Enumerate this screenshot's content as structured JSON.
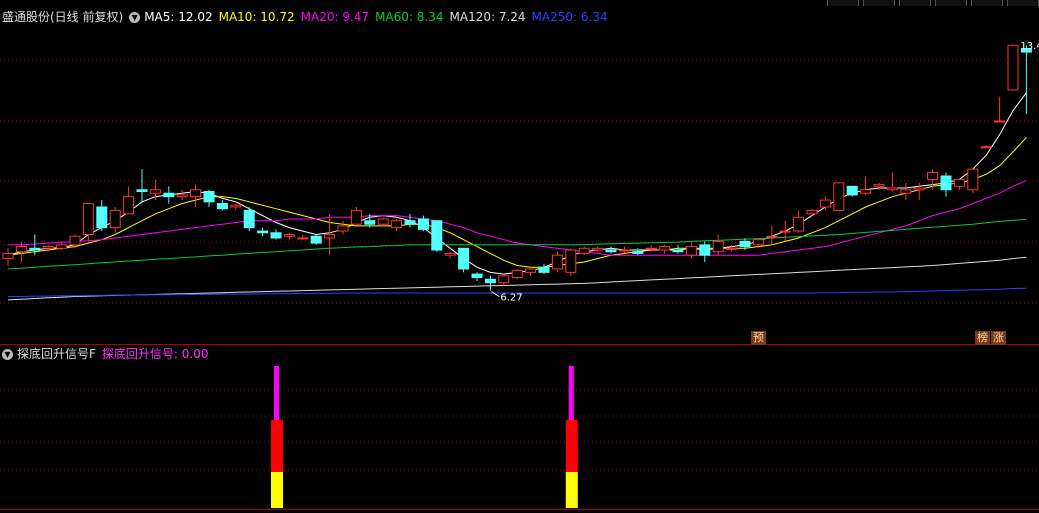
{
  "header": {
    "stock_title": "盛通股份(日线 前复权)",
    "ma": [
      {
        "label": "MA5: 12.02",
        "color": "#ffffff"
      },
      {
        "label": "MA10: 10.72",
        "color": "#ffff00"
      },
      {
        "label": "MA20: 9.47",
        "color": "#ff00ff"
      },
      {
        "label": "MA60: 8.34",
        "color": "#00cc44"
      },
      {
        "label": "MA120: 7.24",
        "color": "#dddddd"
      },
      {
        "label": "MA250: 6.34",
        "color": "#2244ff"
      }
    ]
  },
  "indicator": {
    "title": "探底回升信号F",
    "value_label": "探底回升信号: 0.00",
    "value_color": "#ff33ff"
  },
  "tags": {
    "pre": "预",
    "bang": "榜",
    "zhang": "涨"
  },
  "annotations": {
    "high": "13.4",
    "low": "6.27"
  },
  "chart_data": {
    "type": "candlestick",
    "ylim": [
      5.3,
      13.9
    ],
    "candles": [
      [
        7.2,
        7.5,
        7.0,
        7.35
      ],
      [
        7.4,
        7.7,
        7.1,
        7.55
      ],
      [
        7.5,
        7.9,
        7.3,
        7.45
      ],
      [
        7.5,
        7.6,
        7.4,
        7.55
      ],
      [
        7.5,
        7.7,
        7.45,
        7.6
      ],
      [
        7.6,
        7.9,
        7.5,
        7.85
      ],
      [
        7.9,
        8.8,
        7.7,
        8.8
      ],
      [
        8.7,
        8.9,
        8.0,
        8.1
      ],
      [
        8.1,
        8.7,
        7.95,
        8.6
      ],
      [
        8.5,
        9.3,
        8.5,
        9.0
      ],
      [
        9.2,
        9.8,
        8.8,
        9.15
      ],
      [
        9.1,
        9.5,
        8.9,
        9.2
      ],
      [
        9.1,
        9.3,
        8.8,
        9.0
      ],
      [
        9.0,
        9.2,
        8.9,
        9.05
      ],
      [
        9.0,
        9.35,
        8.7,
        9.2
      ],
      [
        9.15,
        9.2,
        8.7,
        8.85
      ],
      [
        8.8,
        8.9,
        8.6,
        8.65
      ],
      [
        8.7,
        8.8,
        8.6,
        8.75
      ],
      [
        8.6,
        8.7,
        8.0,
        8.1
      ],
      [
        8.0,
        8.1,
        7.85,
        7.95
      ],
      [
        7.95,
        8.05,
        7.75,
        7.8
      ],
      [
        7.85,
        7.95,
        7.75,
        7.9
      ],
      [
        7.8,
        7.9,
        7.75,
        7.8
      ],
      [
        7.85,
        7.9,
        7.6,
        7.65
      ],
      [
        7.8,
        8.5,
        7.3,
        7.9
      ],
      [
        8.0,
        8.3,
        7.9,
        8.15
      ],
      [
        8.2,
        8.7,
        8.2,
        8.6
      ],
      [
        8.3,
        8.5,
        8.1,
        8.2
      ],
      [
        8.2,
        8.4,
        8.15,
        8.35
      ],
      [
        8.1,
        8.35,
        8.0,
        8.3
      ],
      [
        8.3,
        8.5,
        8.1,
        8.2
      ],
      [
        8.35,
        8.45,
        8.0,
        8.05
      ],
      [
        8.3,
        8.3,
        7.4,
        7.45
      ],
      [
        7.3,
        7.4,
        7.2,
        7.35
      ],
      [
        7.5,
        7.5,
        6.8,
        6.9
      ],
      [
        6.75,
        6.8,
        6.55,
        6.65
      ],
      [
        6.6,
        6.7,
        6.27,
        6.5
      ],
      [
        6.5,
        6.75,
        6.4,
        6.7
      ],
      [
        6.65,
        6.9,
        6.6,
        6.85
      ],
      [
        6.8,
        6.95,
        6.7,
        6.9
      ],
      [
        6.95,
        7.05,
        6.75,
        6.8
      ],
      [
        6.9,
        7.4,
        6.8,
        7.3
      ],
      [
        6.8,
        7.5,
        6.7,
        7.45
      ],
      [
        7.35,
        7.55,
        7.3,
        7.5
      ],
      [
        7.45,
        7.55,
        7.4,
        7.5
      ],
      [
        7.45,
        7.55,
        7.35,
        7.4
      ],
      [
        7.45,
        7.55,
        7.35,
        7.45
      ],
      [
        7.4,
        7.5,
        7.3,
        7.35
      ],
      [
        7.5,
        7.6,
        7.4,
        7.5
      ],
      [
        7.45,
        7.6,
        7.35,
        7.55
      ],
      [
        7.45,
        7.6,
        7.35,
        7.4
      ],
      [
        7.3,
        7.7,
        7.2,
        7.55
      ],
      [
        7.6,
        7.7,
        7.1,
        7.3
      ],
      [
        7.4,
        7.9,
        7.3,
        7.7
      ],
      [
        7.5,
        7.6,
        7.4,
        7.5
      ],
      [
        7.7,
        7.8,
        7.45,
        7.55
      ],
      [
        7.6,
        7.8,
        7.5,
        7.75
      ],
      [
        7.85,
        8.15,
        7.6,
        7.85
      ],
      [
        8.0,
        8.3,
        7.7,
        8.0
      ],
      [
        8.0,
        8.6,
        7.95,
        8.4
      ],
      [
        8.5,
        8.65,
        8.45,
        8.6
      ],
      [
        8.7,
        9.0,
        8.6,
        8.9
      ],
      [
        8.6,
        9.4,
        8.6,
        9.4
      ],
      [
        9.3,
        9.3,
        9.0,
        9.05
      ],
      [
        9.1,
        9.6,
        9.05,
        9.2
      ],
      [
        9.3,
        9.4,
        9.2,
        9.35
      ],
      [
        9.2,
        9.7,
        9.15,
        9.25
      ],
      [
        9.1,
        9.4,
        8.9,
        9.2
      ],
      [
        9.2,
        9.4,
        8.9,
        9.25
      ],
      [
        9.5,
        9.8,
        9.2,
        9.7
      ],
      [
        9.6,
        9.7,
        9.0,
        9.2
      ],
      [
        9.3,
        9.5,
        9.2,
        9.5
      ],
      [
        9.2,
        9.8,
        9.1,
        9.8
      ],
      [
        10.45,
        10.5,
        10.45,
        10.45
      ],
      [
        11.2,
        11.9,
        11.2,
        11.2
      ],
      [
        12.1,
        13.4,
        12.1,
        13.4
      ],
      [
        13.3,
        13.4,
        11.4,
        13.2
      ]
    ],
    "ma_lines": [
      {
        "name": "MA5",
        "color": "#ffffff",
        "values": [
          7.3,
          7.4,
          7.45,
          7.5,
          7.52,
          7.6,
          7.9,
          8.1,
          8.3,
          8.55,
          8.85,
          9.0,
          9.05,
          9.1,
          9.15,
          9.1,
          8.95,
          8.85,
          8.65,
          8.45,
          8.25,
          8.1,
          8.0,
          7.9,
          7.95,
          8.05,
          8.25,
          8.4,
          8.45,
          8.4,
          8.3,
          8.1,
          7.8,
          7.5,
          7.2,
          6.95,
          6.8,
          6.75,
          6.8,
          6.85,
          6.95,
          7.1,
          7.3,
          7.4,
          7.45,
          7.5,
          7.45,
          7.45,
          7.45,
          7.45,
          7.45,
          7.5,
          7.45,
          7.5,
          7.55,
          7.6,
          7.7,
          7.85,
          8.0,
          8.2,
          8.45,
          8.7,
          8.95,
          9.1,
          9.2,
          9.25,
          9.25,
          9.25,
          9.3,
          9.35,
          9.4,
          9.5,
          9.8,
          10.2,
          10.8,
          11.5,
          12.02
        ]
      },
      {
        "name": "MA10",
        "color": "#ffff00",
        "values": [
          7.3,
          7.35,
          7.4,
          7.45,
          7.5,
          7.55,
          7.65,
          7.75,
          7.9,
          8.1,
          8.3,
          8.5,
          8.65,
          8.8,
          8.9,
          9.0,
          9.0,
          8.95,
          8.85,
          8.75,
          8.65,
          8.55,
          8.45,
          8.35,
          8.25,
          8.2,
          8.15,
          8.15,
          8.15,
          8.15,
          8.2,
          8.2,
          8.1,
          7.95,
          7.75,
          7.55,
          7.35,
          7.15,
          7.0,
          6.95,
          6.95,
          7.0,
          7.05,
          7.1,
          7.2,
          7.3,
          7.35,
          7.4,
          7.45,
          7.45,
          7.5,
          7.5,
          7.5,
          7.5,
          7.5,
          7.5,
          7.55,
          7.6,
          7.7,
          7.8,
          7.95,
          8.1,
          8.3,
          8.5,
          8.7,
          8.85,
          9.0,
          9.1,
          9.2,
          9.3,
          9.35,
          9.4,
          9.5,
          9.65,
          9.9,
          10.3,
          10.72
        ]
      },
      {
        "name": "MA20",
        "color": "#ff00ff",
        "values": [
          7.6,
          7.6,
          7.62,
          7.65,
          7.67,
          7.7,
          7.72,
          7.75,
          7.8,
          7.85,
          7.9,
          7.95,
          8.0,
          8.05,
          8.1,
          8.15,
          8.2,
          8.25,
          8.3,
          8.3,
          8.3,
          8.35,
          8.35,
          8.35,
          8.4,
          8.4,
          8.4,
          8.45,
          8.45,
          8.45,
          8.4,
          8.35,
          8.3,
          8.2,
          8.1,
          7.95,
          7.85,
          7.75,
          7.65,
          7.6,
          7.55,
          7.5,
          7.45,
          7.4,
          7.35,
          7.3,
          7.3,
          7.3,
          7.3,
          7.3,
          7.3,
          7.3,
          7.3,
          7.3,
          7.3,
          7.3,
          7.3,
          7.35,
          7.4,
          7.45,
          7.5,
          7.55,
          7.65,
          7.75,
          7.85,
          7.95,
          8.05,
          8.15,
          8.3,
          8.45,
          8.55,
          8.65,
          8.8,
          8.95,
          9.1,
          9.3,
          9.47
        ]
      },
      {
        "name": "MA60",
        "color": "#00cc44",
        "values": [
          6.9,
          6.92,
          6.95,
          6.98,
          7.0,
          7.02,
          7.05,
          7.08,
          7.1,
          7.13,
          7.15,
          7.18,
          7.2,
          7.23,
          7.25,
          7.28,
          7.3,
          7.33,
          7.35,
          7.38,
          7.4,
          7.43,
          7.45,
          7.48,
          7.5,
          7.52,
          7.54,
          7.55,
          7.57,
          7.58,
          7.6,
          7.6,
          7.6,
          7.6,
          7.6,
          7.6,
          7.6,
          7.6,
          7.6,
          7.6,
          7.6,
          7.6,
          7.6,
          7.6,
          7.62,
          7.63,
          7.64,
          7.65,
          7.66,
          7.67,
          7.68,
          7.7,
          7.72,
          7.73,
          7.75,
          7.76,
          7.78,
          7.8,
          7.82,
          7.84,
          7.86,
          7.88,
          7.9,
          7.93,
          7.96,
          7.99,
          8.02,
          8.05,
          8.08,
          8.11,
          8.14,
          8.17,
          8.2,
          8.24,
          8.28,
          8.31,
          8.34
        ]
      },
      {
        "name": "MA120",
        "color": "#dddddd",
        "values": [
          6.0,
          6.02,
          6.04,
          6.06,
          6.08,
          6.1,
          6.11,
          6.12,
          6.13,
          6.14,
          6.15,
          6.16,
          6.17,
          6.18,
          6.19,
          6.2,
          6.21,
          6.22,
          6.23,
          6.24,
          6.25,
          6.26,
          6.27,
          6.28,
          6.29,
          6.3,
          6.31,
          6.32,
          6.33,
          6.34,
          6.35,
          6.36,
          6.37,
          6.38,
          6.39,
          6.4,
          6.41,
          6.42,
          6.43,
          6.44,
          6.45,
          6.46,
          6.47,
          6.48,
          6.5,
          6.52,
          6.54,
          6.56,
          6.58,
          6.6,
          6.62,
          6.64,
          6.66,
          6.68,
          6.7,
          6.72,
          6.74,
          6.76,
          6.78,
          6.8,
          6.82,
          6.84,
          6.86,
          6.88,
          6.9,
          6.92,
          6.94,
          6.96,
          6.98,
          7.0,
          7.03,
          7.06,
          7.09,
          7.12,
          7.15,
          7.2,
          7.24
        ]
      },
      {
        "name": "MA250",
        "color": "#2244ff",
        "values": [
          6.1,
          6.1,
          6.11,
          6.11,
          6.12,
          6.12,
          6.13,
          6.13,
          6.14,
          6.14,
          6.15,
          6.15,
          6.15,
          6.16,
          6.16,
          6.16,
          6.17,
          6.17,
          6.17,
          6.18,
          6.18,
          6.18,
          6.19,
          6.19,
          6.19,
          6.2,
          6.2,
          6.2,
          6.2,
          6.2,
          6.2,
          6.2,
          6.2,
          6.2,
          6.2,
          6.2,
          6.2,
          6.2,
          6.2,
          6.2,
          6.2,
          6.2,
          6.2,
          6.2,
          6.2,
          6.2,
          6.2,
          6.2,
          6.2,
          6.2,
          6.2,
          6.2,
          6.2,
          6.2,
          6.2,
          6.2,
          6.2,
          6.2,
          6.2,
          6.2,
          6.2,
          6.21,
          6.21,
          6.22,
          6.22,
          6.23,
          6.23,
          6.24,
          6.25,
          6.26,
          6.27,
          6.28,
          6.29,
          6.3,
          6.31,
          6.33,
          6.34
        ]
      }
    ],
    "signals": [
      {
        "index": 20
      },
      {
        "index": 42
      }
    ]
  }
}
